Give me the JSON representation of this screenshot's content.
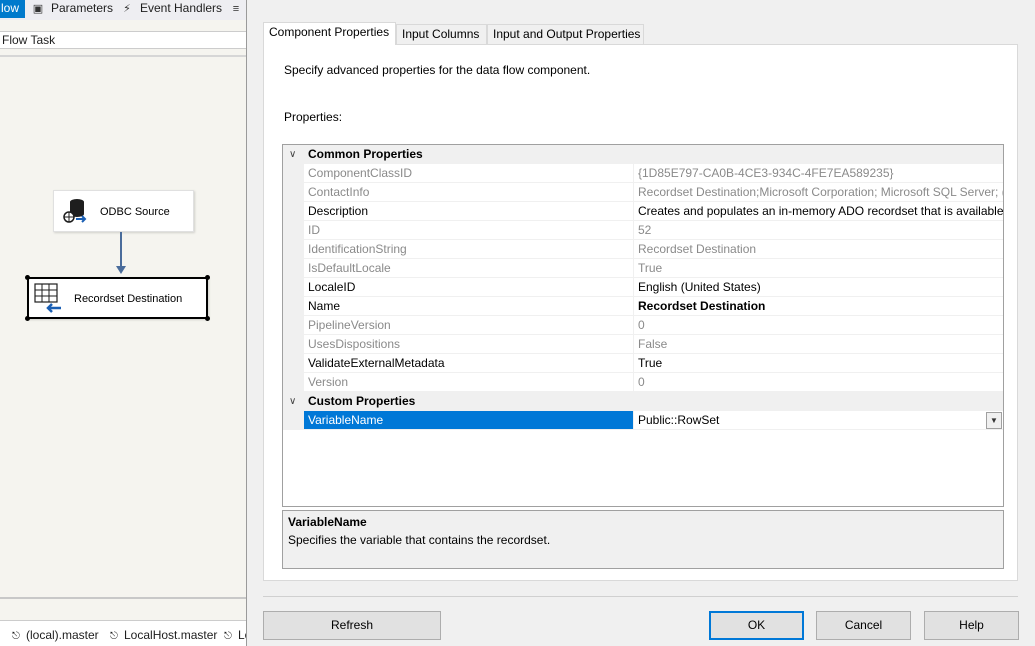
{
  "designer": {
    "tabs": [
      {
        "label": "low",
        "icon": "data-flow-icon"
      },
      {
        "label": "Parameters",
        "icon": "parameters-icon"
      },
      {
        "label": "Event Handlers",
        "icon": "event-handlers-icon"
      },
      {
        "label": "",
        "icon": "package-explorer-icon"
      }
    ],
    "task_name": "Flow Task",
    "nodes": {
      "source": "ODBC Source",
      "destination": "Recordset Destination"
    },
    "connections": [
      "(local).master",
      "LocalHost.master",
      "Lo"
    ]
  },
  "dialog": {
    "tabs": [
      "Component Properties",
      "Input Columns",
      "Input and Output Properties"
    ],
    "active_tab": "Component Properties",
    "intro": "Specify advanced properties for the data flow component.",
    "properties_label": "Properties:",
    "categories": {
      "common": "Common Properties",
      "custom": "Custom Properties"
    },
    "common_properties": [
      {
        "name": "ComponentClassID",
        "value": "{1D85E797-CA0B-4CE3-934C-4FE7EA589235}"
      },
      {
        "name": "ContactInfo",
        "value": "Recordset Destination;Microsoft Corporation; Microsoft SQL Server; (C"
      },
      {
        "name": "Description",
        "value": "Creates and populates an in-memory ADO recordset that is available o"
      },
      {
        "name": "ID",
        "value": "52"
      },
      {
        "name": "IdentificationString",
        "value": "Recordset Destination"
      },
      {
        "name": "IsDefaultLocale",
        "value": "True"
      },
      {
        "name": "LocaleID",
        "value": "English (United States)"
      },
      {
        "name": "Name",
        "value": "Recordset Destination"
      },
      {
        "name": "PipelineVersion",
        "value": "0"
      },
      {
        "name": "UsesDispositions",
        "value": "False"
      },
      {
        "name": "ValidateExternalMetadata",
        "value": "True"
      },
      {
        "name": "Version",
        "value": "0"
      }
    ],
    "custom_properties": [
      {
        "name": "VariableName",
        "value": "Public::RowSet"
      }
    ],
    "description_panel": {
      "title": "VariableName",
      "text": "Specifies the variable that contains the recordset."
    },
    "buttons": {
      "refresh": "Refresh",
      "ok": "OK",
      "cancel": "Cancel",
      "help": "Help"
    },
    "colors": {
      "selection": "#0078d7",
      "accent_tab": "#007acc",
      "connector": "#4a6c9b"
    }
  }
}
